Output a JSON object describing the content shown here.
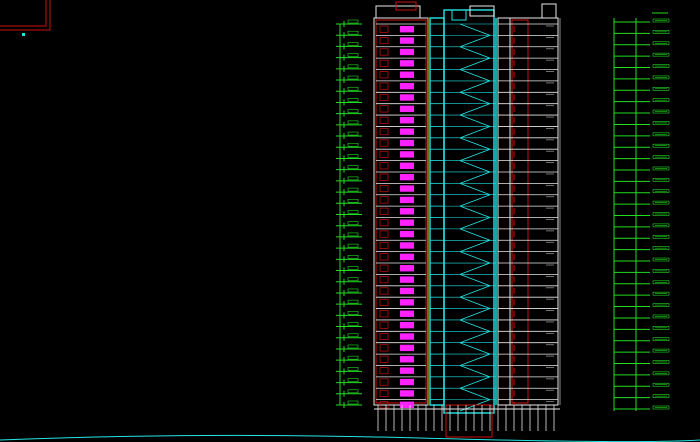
{
  "colors": {
    "background": "#000000",
    "green": "#22dd22",
    "cyan": "#22e6e6",
    "magenta": "#ff22ff",
    "red": "#cc1111",
    "white": "#e8e8e8",
    "yellow": "#dddd22",
    "grey": "#8c8c8c"
  },
  "drawing": {
    "floor_count": 34
  }
}
